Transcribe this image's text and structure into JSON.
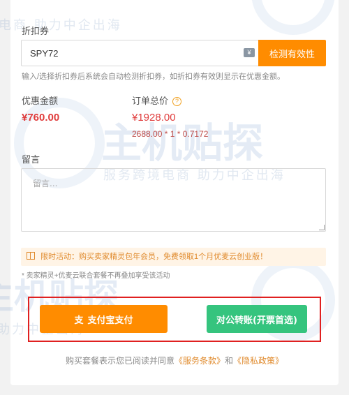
{
  "coupon": {
    "label": "折扣券",
    "value": "SPY72",
    "icon": "coupon-ticket-icon",
    "icon_glyph": "¥",
    "check_button": "检测有效性",
    "hint": "输入/选择折扣券后系统会自动检测折扣券，如折扣券有效则显示在优惠金额。"
  },
  "discount": {
    "label": "优惠金额",
    "value": "¥760.00"
  },
  "order_total": {
    "label": "订单总价",
    "help_glyph": "?",
    "value": "¥1928.00",
    "formula": "2688.00 * 1 * 0.7172"
  },
  "remark": {
    "label": "留言",
    "placeholder": "留言..."
  },
  "promo": {
    "text": "限时活动：购买卖家精灵包年会员，免费领取1个月优麦云创业版！",
    "note": "* 卖家精灵+优麦云联合套餐不再叠加享受该活动"
  },
  "payment": {
    "alipay_label": "支付宝支付",
    "alipay_icon_glyph": "支",
    "transfer_label": "对公转账(开票首选)"
  },
  "footer": {
    "prefix": "购买套餐表示您已阅读并同意",
    "terms": "《服务条款》",
    "and": "和",
    "privacy": "《隐私政策》"
  },
  "watermark": {
    "text_top": "电商  助力中企出海",
    "logo": "主机贴探",
    "text_mid": "服务跨境电商  助力中企出海",
    "text_bottom": "助力中企出海"
  },
  "colors": {
    "accent": "#ff8c00",
    "green": "#35c47e",
    "price_red": "#e03c3c",
    "highlight_box": "#e02020"
  }
}
